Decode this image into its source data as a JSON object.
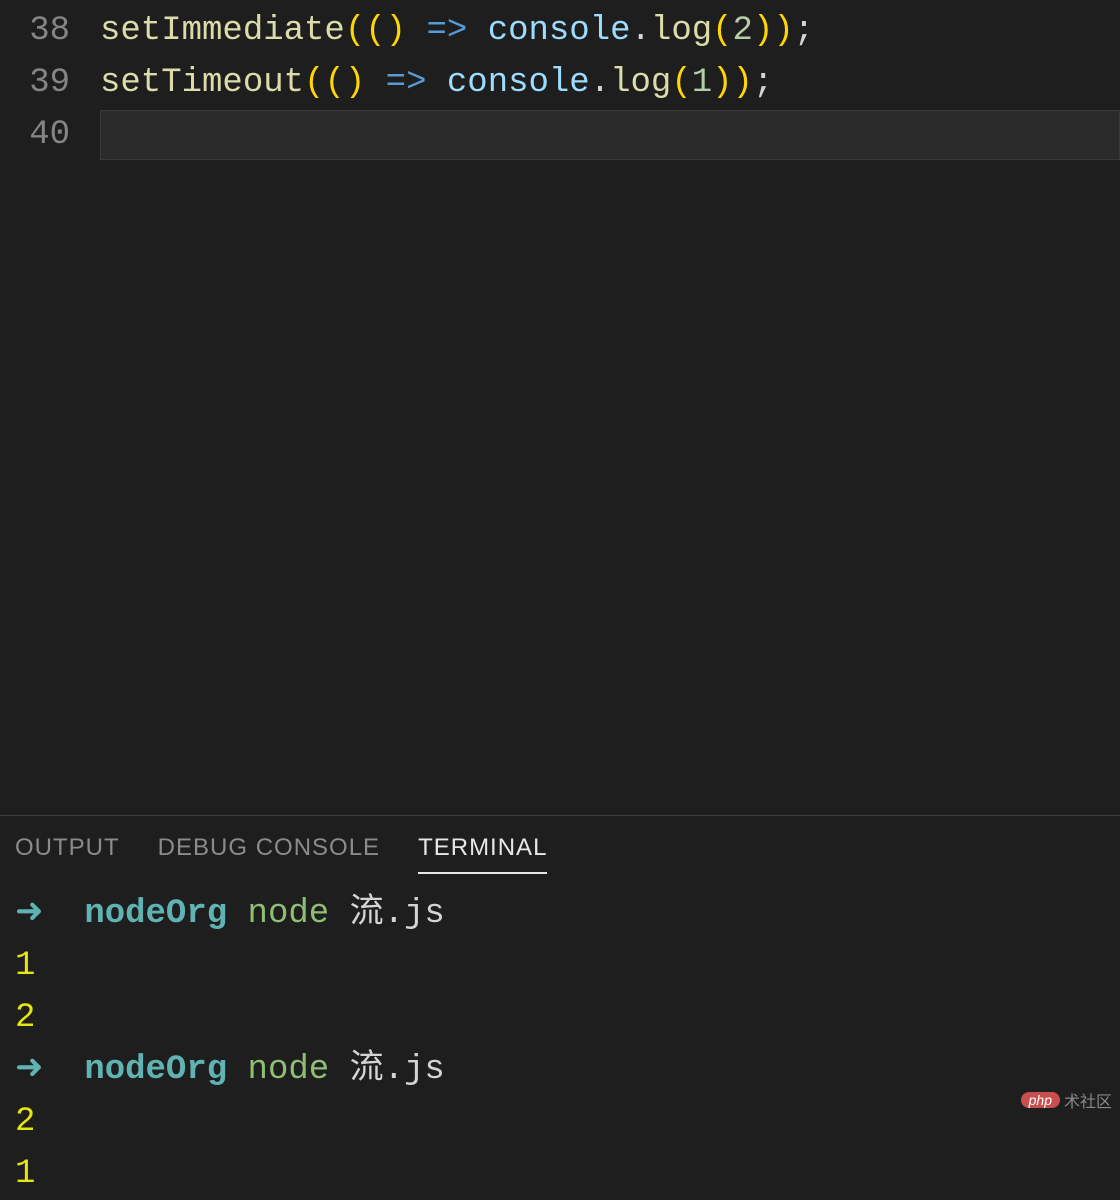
{
  "editor": {
    "lines": [
      {
        "num": "38",
        "tokens": [
          {
            "t": "setImmediate",
            "c": "tk-fn"
          },
          {
            "t": "(()",
            "c": "tk-paren"
          },
          {
            "t": " ",
            "c": ""
          },
          {
            "t": "=>",
            "c": "tk-arrow"
          },
          {
            "t": " ",
            "c": ""
          },
          {
            "t": "console",
            "c": "tk-obj"
          },
          {
            "t": ".",
            "c": "tk-dot"
          },
          {
            "t": "log",
            "c": "tk-fn"
          },
          {
            "t": "(",
            "c": "tk-paren"
          },
          {
            "t": "2",
            "c": "tk-num"
          },
          {
            "t": "))",
            "c": "tk-paren"
          },
          {
            "t": ";",
            "c": "tk-semi"
          }
        ]
      },
      {
        "num": "39",
        "tokens": [
          {
            "t": "setTimeout",
            "c": "tk-fn"
          },
          {
            "t": "(()",
            "c": "tk-paren"
          },
          {
            "t": " ",
            "c": ""
          },
          {
            "t": "=>",
            "c": "tk-arrow"
          },
          {
            "t": " ",
            "c": ""
          },
          {
            "t": "console",
            "c": "tk-obj"
          },
          {
            "t": ".",
            "c": "tk-dot"
          },
          {
            "t": "log",
            "c": "tk-fn"
          },
          {
            "t": "(",
            "c": "tk-paren"
          },
          {
            "t": "1",
            "c": "tk-num"
          },
          {
            "t": "))",
            "c": "tk-paren"
          },
          {
            "t": ";",
            "c": "tk-semi"
          }
        ]
      },
      {
        "num": "40",
        "current": true,
        "tokens": []
      }
    ]
  },
  "panel": {
    "tabs": [
      {
        "label": "OUTPUT",
        "active": false
      },
      {
        "label": "DEBUG CONSOLE",
        "active": false
      },
      {
        "label": "TERMINAL",
        "active": true
      }
    ],
    "terminal": [
      {
        "type": "prompt",
        "arrow": "➜",
        "cwd": "nodeOrg",
        "cmd": "node",
        "arg": "流.js"
      },
      {
        "type": "out",
        "text": "1"
      },
      {
        "type": "out",
        "text": "2"
      },
      {
        "type": "prompt",
        "arrow": "➜",
        "cwd": "nodeOrg",
        "cmd": "node",
        "arg": "流.js"
      },
      {
        "type": "out",
        "text": "2"
      },
      {
        "type": "out",
        "text": "1"
      }
    ]
  },
  "watermark": {
    "pill": "php",
    "text": "术社区"
  }
}
